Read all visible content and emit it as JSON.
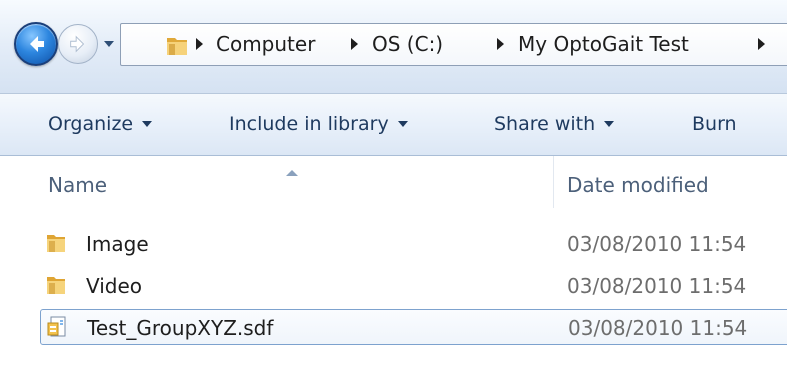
{
  "colors": {
    "nav_blue": "#2d86df",
    "toolbar_text": "#1e3a5f",
    "header_text": "#4c607a",
    "date_text": "#6d6d6d",
    "selection_border": "#7da2ce"
  },
  "address_bar": {
    "crumbs": [
      "Computer",
      "OS (C:)",
      "My OptoGait Test"
    ],
    "folder_icon": "folder-icon"
  },
  "toolbar": {
    "organize_label": "Organize",
    "include_label": "Include in library",
    "share_label": "Share with",
    "burn_label": "Burn"
  },
  "columns": {
    "name": "Name",
    "date_modified": "Date modified",
    "sort_column": "Name"
  },
  "files": [
    {
      "name": "Image",
      "date": "03/08/2010 11:54",
      "icon": "folder-icon",
      "selected": false
    },
    {
      "name": "Video",
      "date": "03/08/2010 11:54",
      "icon": "folder-icon",
      "selected": false
    },
    {
      "name": "Test_GroupXYZ.sdf",
      "date": "03/08/2010 11:54",
      "icon": "sdf-file-icon",
      "selected": true
    }
  ]
}
